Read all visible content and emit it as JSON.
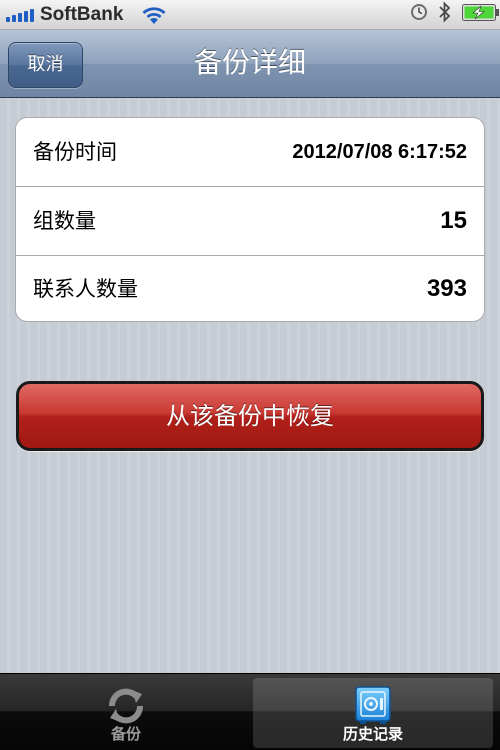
{
  "status_bar": {
    "carrier": "SoftBank",
    "icons": [
      "signal-icon",
      "wifi-icon",
      "alarm-clock-icon",
      "bluetooth-icon",
      "battery-charging-icon"
    ]
  },
  "nav_bar": {
    "title": "备份详细",
    "cancel_label": "取消"
  },
  "details": {
    "rows": [
      {
        "label": "备份时间",
        "value": "2012/07/08 6:17:52"
      },
      {
        "label": "组数量",
        "value": "15"
      },
      {
        "label": "联系人数量",
        "value": "393"
      }
    ]
  },
  "actions": {
    "restore_label": "从该备份中恢复"
  },
  "tab_bar": {
    "tabs": [
      {
        "label": "备份",
        "icon": "sync-arrows-icon",
        "selected": false
      },
      {
        "label": "历史记录",
        "icon": "vault-icon",
        "selected": true
      }
    ]
  },
  "colors": {
    "accent_red": "#b1201a",
    "nav_blue": "#7f94b0",
    "battery_green": "#4cd639"
  }
}
